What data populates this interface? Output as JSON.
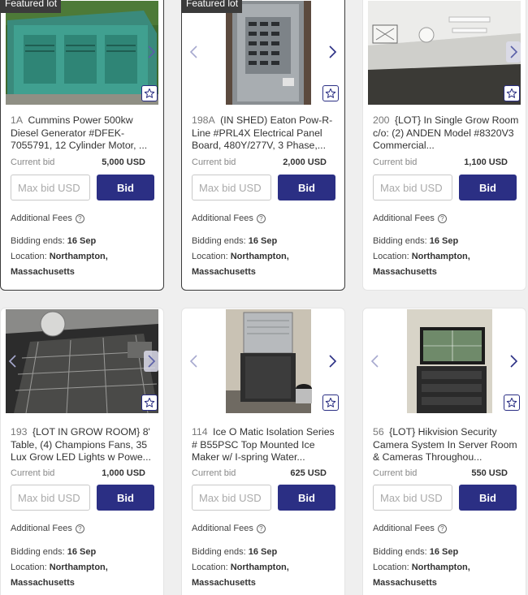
{
  "labels": {
    "featured": "Featured lot",
    "current_bid": "Current bid",
    "max_bid_placeholder": "Max bid USD",
    "bid": "Bid",
    "additional_fees": "Additional Fees",
    "bidding_ends": "Bidding ends:",
    "location": "Location:"
  },
  "colors": {
    "accent": "#2b2f84",
    "featured_tag": "#3b3b3b",
    "background": "#efefef"
  },
  "lots": [
    {
      "featured": true,
      "lot_no": "1A",
      "title": "Cummins Power 500kw Diesel Generator #DFEK-7055791, 12 Cylinder Motor, ...",
      "current_bid": "5,000 USD",
      "ends": "16 Sep",
      "location_city": "Northampton,",
      "location_state": "Massachusetts",
      "image": "green-diesel-generator"
    },
    {
      "featured": true,
      "lot_no": "198A",
      "title": "(IN SHED) Eaton Pow-R-Line #PRL4X Electrical Panel Board, 480Y/277V, 3 Phase,...",
      "current_bid": "2,000 USD",
      "ends": "16 Sep",
      "location_city": "Northampton,",
      "location_state": "Massachusetts",
      "image": "electrical-panel"
    },
    {
      "featured": false,
      "lot_no": "200",
      "title": "{LOT} In Single Grow Room c/o: (2) ANDEN Model #8320V3 Commercial...",
      "current_bid": "1,100 USD",
      "ends": "16 Sep",
      "location_city": "Northampton,",
      "location_state": "Massachusetts",
      "image": "empty-grow-room"
    },
    {
      "featured": false,
      "lot_no": "193",
      "title": "{LOT IN GROW ROOM} 8' Table, (4) Champions Fans, 35 Lux Grow LED Lights w Powe...",
      "current_bid": "1,000 USD",
      "ends": "16 Sep",
      "location_city": "Northampton,",
      "location_state": "Massachusetts",
      "image": "grow-room-tables"
    },
    {
      "featured": false,
      "lot_no": "114",
      "title": "Ice O Matic Isolation Series # B55PSC Top Mounted Ice Maker w/ I-spring Water...",
      "current_bid": "625 USD",
      "ends": "16 Sep",
      "location_city": "Northampton,",
      "location_state": "Massachusetts",
      "image": "ice-maker"
    },
    {
      "featured": false,
      "lot_no": "56",
      "title": "{LOT} Hikvision Security Camera System In Server Room & Cameras Throughou...",
      "current_bid": "550 USD",
      "ends": "16 Sep",
      "location_city": "Northampton,",
      "location_state": "Massachusetts",
      "image": "security-monitor-rack"
    }
  ]
}
